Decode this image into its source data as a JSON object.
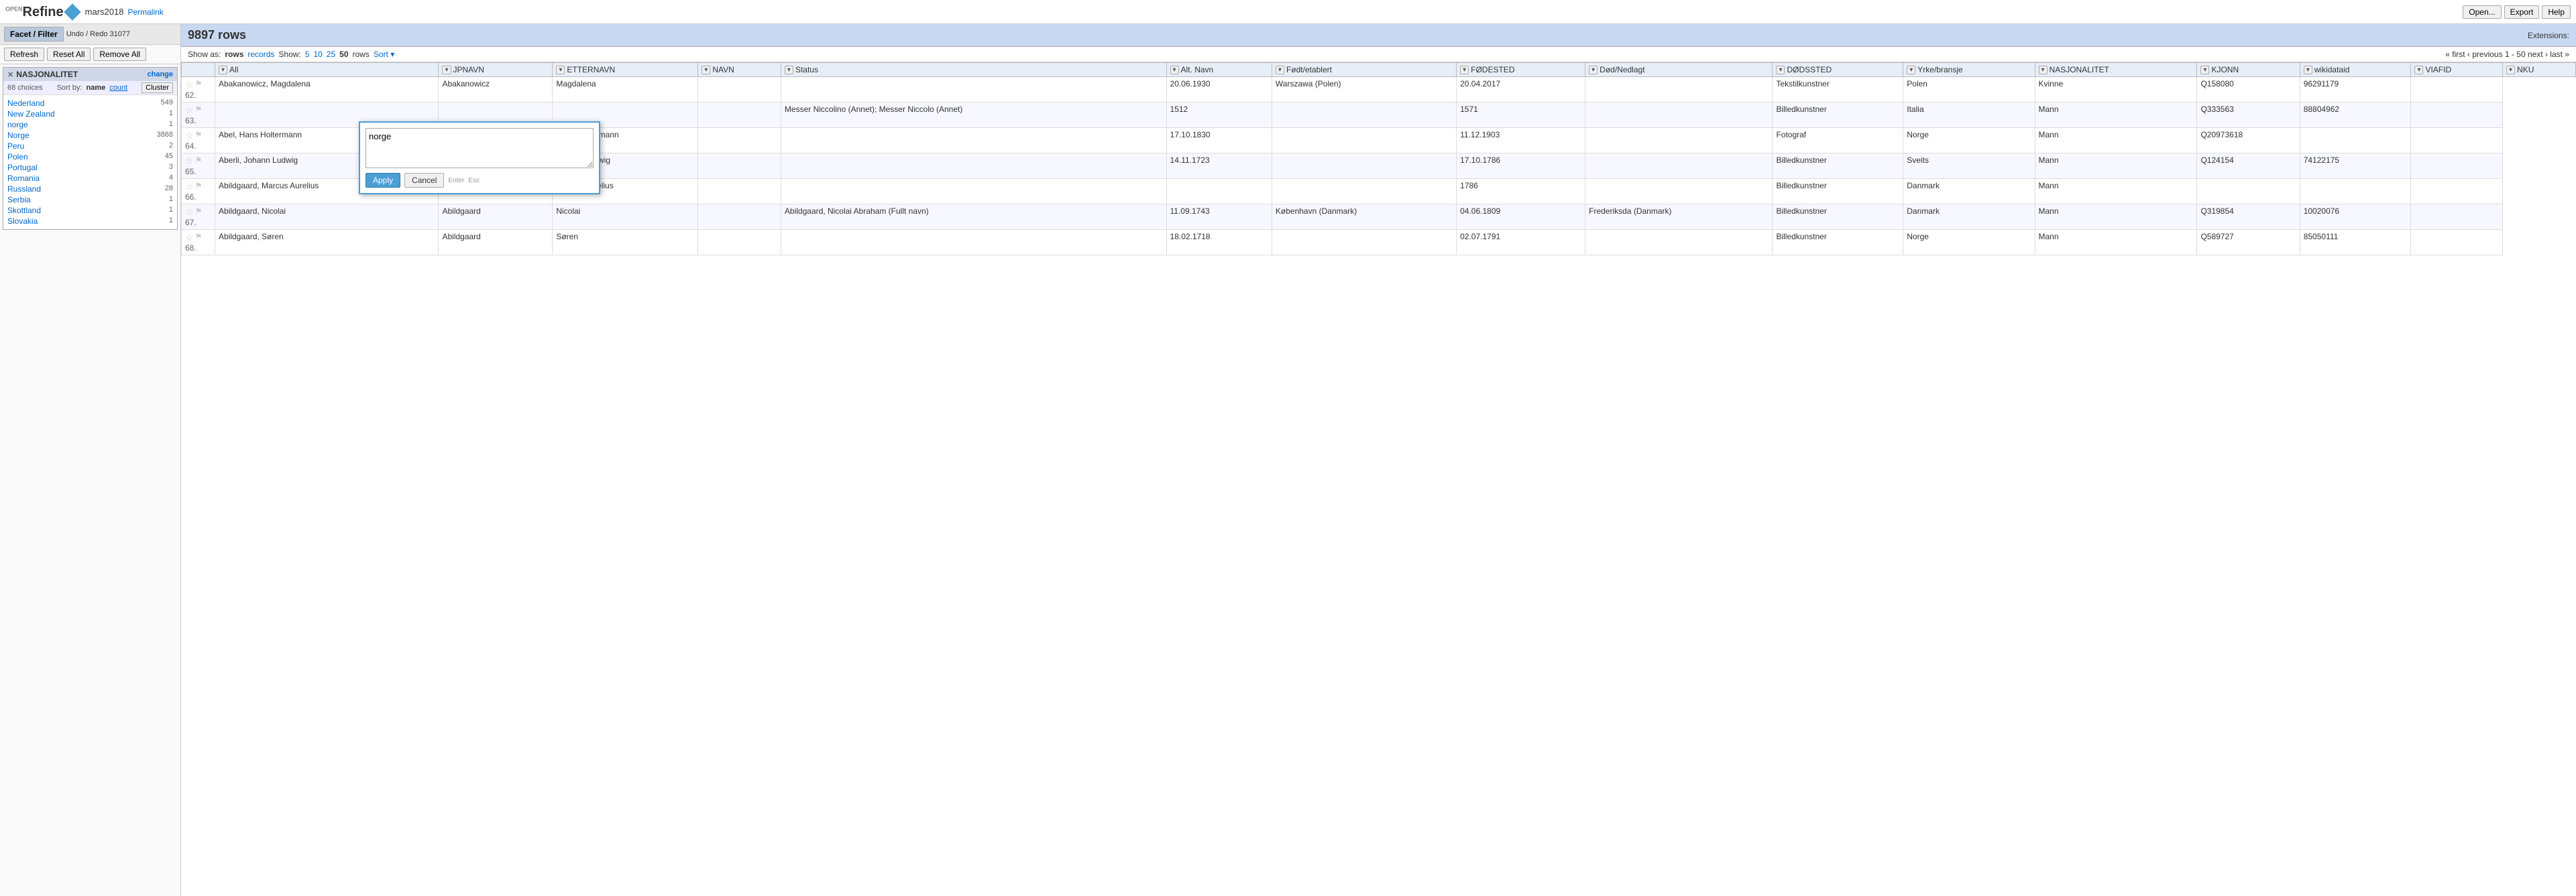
{
  "header": {
    "project": "mars2018",
    "permalink": "Permalink",
    "open_btn": "Open...",
    "export_btn": "Export",
    "help_btn": "Help"
  },
  "sidebar": {
    "facet_tab": "Facet / Filter",
    "undo_redo": "Undo / Redo 31077",
    "refresh_btn": "Refresh",
    "reset_btn": "Reset All",
    "remove_btn": "Remove All",
    "facet": {
      "title": "NASJONALITET",
      "change": "change",
      "choices": "68 choices",
      "sort_label": "Sort by:",
      "sort_name": "name",
      "sort_count": "count",
      "cluster_btn": "Cluster",
      "items": [
        {
          "name": "Nederland",
          "count": 549
        },
        {
          "name": "New Zealand",
          "count": 1
        },
        {
          "name": "norge",
          "count": 1
        },
        {
          "name": "Norge",
          "count": 3868
        },
        {
          "name": "Peru",
          "count": 2
        },
        {
          "name": "Polen",
          "count": 45
        },
        {
          "name": "Portugal",
          "count": 3
        },
        {
          "name": "Romania",
          "count": 4
        },
        {
          "name": "Russland",
          "count": 28
        },
        {
          "name": "Serbia",
          "count": 1
        },
        {
          "name": "Skottland",
          "count": 1
        },
        {
          "name": "Slovakia",
          "count": 1
        }
      ]
    }
  },
  "content": {
    "row_count": "9897 rows",
    "extensions_label": "Extensions:",
    "show_as_label": "Show as:",
    "rows_link": "rows",
    "records_link": "records",
    "show_label": "Show:",
    "show_options": [
      "5",
      "10",
      "25",
      "50"
    ],
    "show_active": "50",
    "rows_label": "rows",
    "sort_btn": "Sort",
    "pagination": "« first ‹ previous  1 - 50  next › last »"
  },
  "columns": [
    {
      "id": "all",
      "label": "All"
    },
    {
      "id": "jpnavn",
      "label": "JPNAVN"
    },
    {
      "id": "etternavn",
      "label": "ETTERNAVN"
    },
    {
      "id": "navn",
      "label": "NAVN"
    },
    {
      "id": "status",
      "label": "Status"
    },
    {
      "id": "altnavn",
      "label": "Alt. Navn"
    },
    {
      "id": "fodt",
      "label": "Født/etablert"
    },
    {
      "id": "fodested",
      "label": "FØDESTED"
    },
    {
      "id": "dod",
      "label": "Død/Nedlagt"
    },
    {
      "id": "dodssted",
      "label": "DØDSSTED"
    },
    {
      "id": "yrke",
      "label": "Yrke/bransje"
    },
    {
      "id": "nasjonalitet",
      "label": "NASJONALITET"
    },
    {
      "id": "kjonn",
      "label": "KJONN"
    },
    {
      "id": "wikidataid",
      "label": "wikidataid"
    },
    {
      "id": "viafid",
      "label": "VIAFID"
    },
    {
      "id": "nku",
      "label": "NKU"
    }
  ],
  "rows": [
    {
      "num": "62.",
      "jpnavn": "Abakanowicz, Magdalena",
      "etternavn": "Abakanowicz",
      "navn": "Magdalena",
      "status": "",
      "altnavn": "",
      "fodt": "20.06.1930",
      "fodested": "Warszawa (Polen)",
      "dod": "20.04.2017",
      "dodssted": "",
      "yrke": "Tekstilkunstner",
      "nasjonalitet": "Polen",
      "kjonn": "Kvinne",
      "wikidataid": "Q158080",
      "viafid": "96291179",
      "nku": ""
    },
    {
      "num": "63.",
      "jpnavn": "",
      "etternavn": "",
      "navn": "",
      "status": "",
      "altnavn": "Messer Niccolino (Annet); Messer Niccolo (Annet)",
      "fodt": "1512",
      "fodested": "",
      "dod": "1571",
      "dodssted": "",
      "yrke": "Billedkunstner",
      "nasjonalitet": "Italia",
      "kjonn": "Mann",
      "wikidataid": "Q333563",
      "viafid": "88804962",
      "nku": ""
    },
    {
      "num": "64.",
      "jpnavn": "Abel, Hans Holtermann",
      "etternavn": "Abel",
      "navn": "Hans Holtermann",
      "status": "",
      "altnavn": "",
      "fodt": "17.10.1830",
      "fodested": "",
      "dod": "11.12.1903",
      "dodssted": "",
      "yrke": "Fotograf",
      "nasjonalitet": "Norge",
      "kjonn": "Mann",
      "wikidataid": "Q20973618",
      "viafid": "",
      "nku": ""
    },
    {
      "num": "65.",
      "jpnavn": "Aberli, Johann Ludwig",
      "etternavn": "Aberli",
      "navn": "Johann Ludwig",
      "status": "",
      "altnavn": "",
      "fodt": "14.11.1723",
      "fodested": "",
      "dod": "17.10.1786",
      "dodssted": "",
      "yrke": "Billedkunstner",
      "nasjonalitet": "Sveits",
      "kjonn": "Mann",
      "wikidataid": "Q124154",
      "viafid": "74122175",
      "nku": ""
    },
    {
      "num": "66.",
      "jpnavn": "Abildgaard, Marcus Aurelius",
      "etternavn": "Abildgaard",
      "navn": "Marcus Aurelius",
      "status": "",
      "altnavn": "",
      "fodt": "",
      "fodested": "",
      "dod": "1786",
      "dodssted": "",
      "yrke": "Billedkunstner",
      "nasjonalitet": "Danmark",
      "kjonn": "Mann",
      "wikidataid": "",
      "viafid": "",
      "nku": ""
    },
    {
      "num": "67.",
      "jpnavn": "Abildgaard, Nicolai",
      "etternavn": "Abildgaard",
      "navn": "Nicolai",
      "status": "",
      "altnavn": "Abildgaard, Nicolai Abraham (Fullt navn)",
      "fodt": "11.09.1743",
      "fodested": "København (Danmark)",
      "dod": "04.06.1809",
      "dodssted": "Frederiksda (Danmark)",
      "yrke": "Billedkunstner",
      "nasjonalitet": "Danmark",
      "kjonn": "Mann",
      "wikidataid": "Q319854",
      "viafid": "10020076",
      "nku": ""
    },
    {
      "num": "68.",
      "jpnavn": "Abildgaard, Søren",
      "etternavn": "Abildgaard",
      "navn": "Søren",
      "status": "",
      "altnavn": "",
      "fodt": "18.02.1718",
      "fodested": "",
      "dod": "02.07.1791",
      "dodssted": "",
      "yrke": "Billedkunstner",
      "nasjonalitet": "Norge",
      "kjonn": "Mann",
      "wikidataid": "Q589727",
      "viafid": "85050111",
      "nku": ""
    }
  ],
  "edit_overlay": {
    "value": "norge",
    "apply_btn": "Apply",
    "cancel_btn": "Cancel",
    "enter_hint": "Enter",
    "esc_hint": "Esc"
  }
}
